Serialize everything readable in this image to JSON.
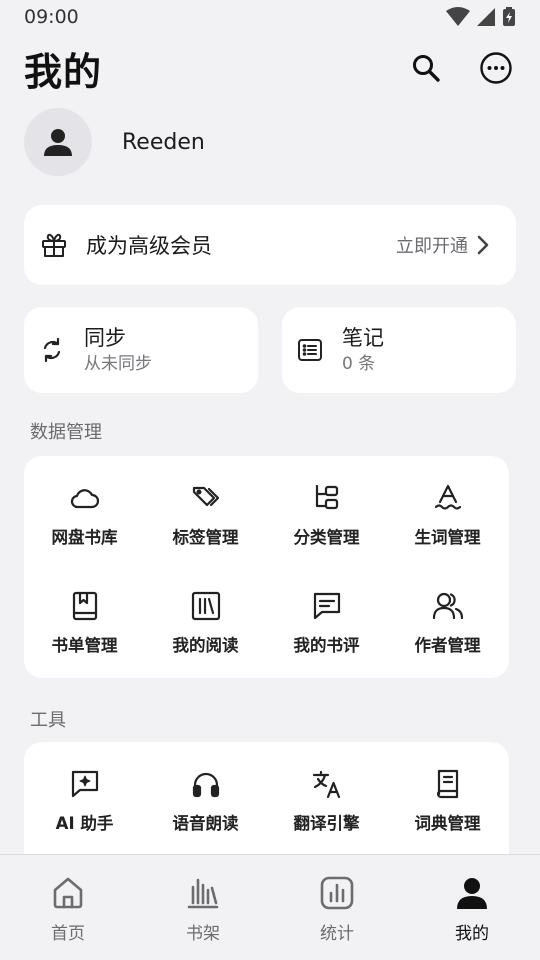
{
  "status_bar": {
    "time": "09:00"
  },
  "header": {
    "title": "我的"
  },
  "profile": {
    "username": "Reeden"
  },
  "vip": {
    "label": "成为高级会员",
    "action": "立即开通"
  },
  "sync": {
    "title": "同步",
    "subtitle": "从未同步"
  },
  "notes": {
    "title": "笔记",
    "subtitle": "0 条"
  },
  "data_management": {
    "title": "数据管理",
    "items": [
      {
        "label": "网盘书库",
        "icon": "cloud-icon"
      },
      {
        "label": "标签管理",
        "icon": "tags-icon"
      },
      {
        "label": "分类管理",
        "icon": "category-icon"
      },
      {
        "label": "生词管理",
        "icon": "vocabulary-icon"
      },
      {
        "label": "书单管理",
        "icon": "booklist-icon"
      },
      {
        "label": "我的阅读",
        "icon": "library-icon"
      },
      {
        "label": "我的书评",
        "icon": "review-icon"
      },
      {
        "label": "作者管理",
        "icon": "authors-icon"
      }
    ]
  },
  "tools": {
    "title": "工具",
    "items": [
      {
        "label": "AI 助手",
        "icon": "ai-chat-icon"
      },
      {
        "label": "语音朗读",
        "icon": "headphones-icon"
      },
      {
        "label": "翻译引擎",
        "icon": "translate-icon"
      },
      {
        "label": "词典管理",
        "icon": "dictionary-icon"
      }
    ]
  },
  "bottom_nav": {
    "items": [
      {
        "label": "首页",
        "icon": "home-icon"
      },
      {
        "label": "书架",
        "icon": "bookshelf-icon"
      },
      {
        "label": "统计",
        "icon": "stats-icon"
      },
      {
        "label": "我的",
        "icon": "person-icon",
        "active": true
      }
    ]
  },
  "colors": {
    "background": "#f2f2f4",
    "card": "#ffffff",
    "text": "#1c1c1e",
    "secondary_text": "#6b6b70"
  }
}
